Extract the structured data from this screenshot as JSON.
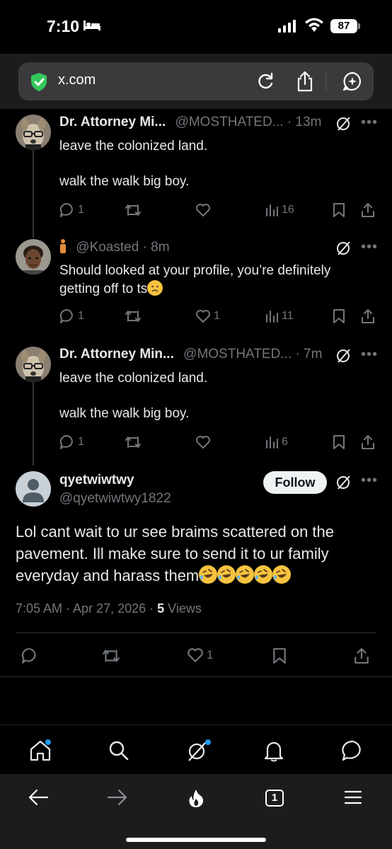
{
  "status_bar": {
    "time": "7:10",
    "battery": "87"
  },
  "browser": {
    "domain": "x.com"
  },
  "tweets": [
    {
      "name": "Dr. Attorney Mi...",
      "handle": "@MOSTHATED...",
      "time": "· 13m",
      "lines": [
        "leave the colonized land.",
        "walk the walk big boy."
      ],
      "replies": "1",
      "retweets": "",
      "likes": "",
      "views": "16"
    },
    {
      "name": "",
      "handle": "@Koasted",
      "time": "· 8m",
      "lines": [
        "Should looked at your profile, you’re definitely",
        "getting off to ts"
      ],
      "replies": "1",
      "retweets": "",
      "likes": "1",
      "views": "11"
    },
    {
      "name": "Dr. Attorney Min...",
      "handle": "@MOSTHATED...",
      "time": "· 7m",
      "lines": [
        "leave the colonized land.",
        "walk the walk big boy."
      ],
      "replies": "1",
      "retweets": "",
      "likes": "",
      "views": "6"
    }
  ],
  "main_tweet": {
    "name": "qyetwiwtwy",
    "handle": "@qyetwiwtwy1822",
    "follow_label": "Follow",
    "text_lines": [
      "Lol cant wait to ur see braims scattered on the",
      "pavement. Ill make sure to send it to ur family",
      "everyday and harass them"
    ],
    "timestamp": "7:05 AM · Apr 27, 2026 · ",
    "views_count": "5",
    "views_label": " Views",
    "likes": "1"
  },
  "colors": {
    "background": "#000000",
    "text": "#e7e9ea",
    "muted": "#71767b",
    "accent": "#1d9bf0",
    "emoji": "#f7c33f"
  },
  "icons": {
    "nav": [
      "home-icon",
      "search-icon",
      "grok-icon",
      "notifications-icon",
      "messages-icon"
    ],
    "browser": [
      "back-icon",
      "forward-icon",
      "flame-icon",
      "tabs-icon",
      "menu-icon"
    ]
  },
  "browser_tabs_count": "1"
}
